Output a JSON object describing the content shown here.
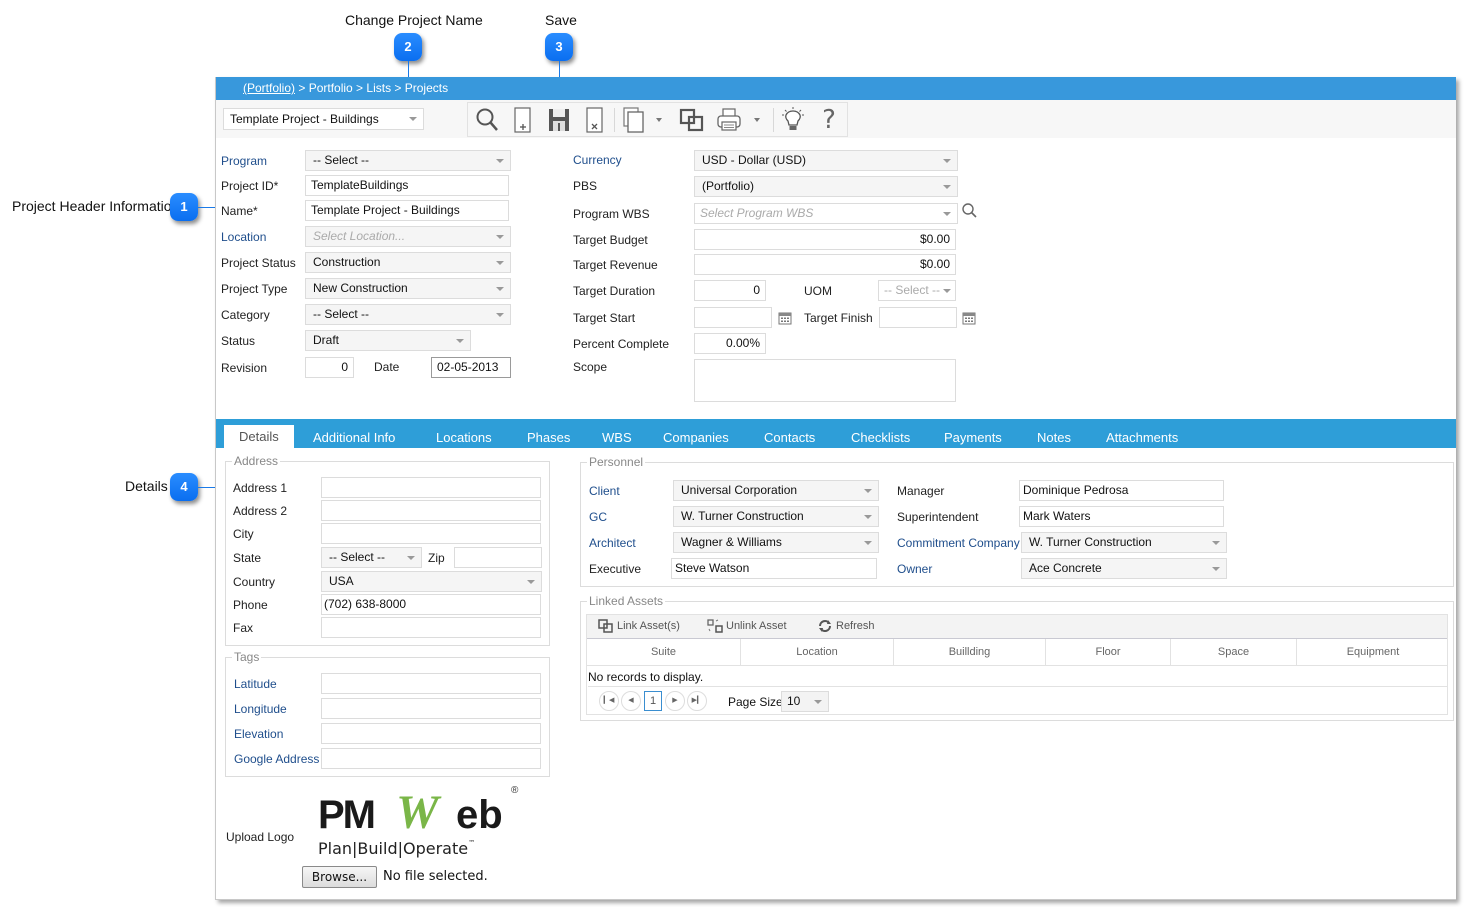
{
  "callouts": [
    {
      "number": "1",
      "label": "Project Header Information"
    },
    {
      "number": "2",
      "label": "Change Project Name"
    },
    {
      "number": "3",
      "label": "Save"
    },
    {
      "number": "4",
      "label": "Details"
    }
  ],
  "breadcrumb": {
    "link": "(Portfolio)",
    "rest": " > Portfolio > Lists > Projects"
  },
  "project_selector": {
    "value": "Template Project - Buildings"
  },
  "toolbar": {
    "icons": [
      "search-icon",
      "new-document-icon",
      "save-icon",
      "delete-document-icon",
      "copy-icon",
      "link-icon",
      "print-icon",
      "lightbulb-icon",
      "help-icon"
    ],
    "help_glyph": "?"
  },
  "header_left": {
    "program": {
      "label": "Program",
      "value": "-- Select --"
    },
    "project_id": {
      "label": "Project ID*",
      "value": "TemplateBuildings"
    },
    "name": {
      "label": "Name*",
      "value": "Template Project - Buildings"
    },
    "location": {
      "label": "Location",
      "placeholder": "Select Location..."
    },
    "project_status": {
      "label": "Project Status",
      "value": "Construction"
    },
    "project_type": {
      "label": "Project Type",
      "value": "New Construction"
    },
    "category": {
      "label": "Category",
      "value": "-- Select --"
    },
    "status": {
      "label": "Status",
      "value": "Draft"
    },
    "revision": {
      "label": "Revision",
      "value": "0"
    },
    "date": {
      "label": "Date",
      "value": "02-05-2013"
    }
  },
  "header_right": {
    "currency": {
      "label": "Currency",
      "value": "USD - Dollar (USD)"
    },
    "pbs": {
      "label": "PBS",
      "value": "(Portfolio)"
    },
    "program_wbs": {
      "label": "Program WBS",
      "placeholder": "Select Program WBS"
    },
    "target_budget": {
      "label": "Target Budget",
      "value": "$0.00"
    },
    "target_revenue": {
      "label": "Target Revenue",
      "value": "$0.00"
    },
    "target_duration": {
      "label": "Target Duration",
      "value": "0"
    },
    "uom": {
      "label": "UOM",
      "value": "-- Select --"
    },
    "target_start": {
      "label": "Target Start",
      "value": ""
    },
    "target_finish": {
      "label": "Target Finish",
      "value": ""
    },
    "percent_complete": {
      "label": "Percent Complete",
      "value": "0.00%"
    },
    "scope": {
      "label": "Scope",
      "value": ""
    }
  },
  "tabs": [
    {
      "label": "Details",
      "active": true
    },
    {
      "label": "Additional Info"
    },
    {
      "label": "Locations"
    },
    {
      "label": "Phases"
    },
    {
      "label": "WBS"
    },
    {
      "label": "Companies"
    },
    {
      "label": "Contacts"
    },
    {
      "label": "Checklists"
    },
    {
      "label": "Payments"
    },
    {
      "label": "Notes"
    },
    {
      "label": "Attachments"
    }
  ],
  "address": {
    "legend": "Address",
    "address1": {
      "label": "Address 1",
      "value": ""
    },
    "address2": {
      "label": "Address 2",
      "value": ""
    },
    "city": {
      "label": "City",
      "value": ""
    },
    "state": {
      "label": "State",
      "value": "-- Select --"
    },
    "zip": {
      "label": "Zip",
      "value": ""
    },
    "country": {
      "label": "Country",
      "value": "USA"
    },
    "phone": {
      "label": "Phone",
      "value": "(702) 638-8000"
    },
    "fax": {
      "label": "Fax",
      "value": ""
    }
  },
  "tags": {
    "legend": "Tags",
    "latitude": {
      "label": "Latitude",
      "value": ""
    },
    "longitude": {
      "label": "Longitude",
      "value": ""
    },
    "elevation": {
      "label": "Elevation",
      "value": ""
    },
    "google_address": {
      "label": "Google Address",
      "value": ""
    }
  },
  "logo": {
    "label": "Upload Logo",
    "brand_pm": "PM",
    "brand_w": "W",
    "brand_eb": "eb",
    "registered": "®",
    "tagline": "Plan|Build|Operate",
    "tm": "™",
    "browse_label": "Browse...",
    "file_status": "No file selected."
  },
  "personnel": {
    "legend": "Personnel",
    "client": {
      "label": "Client",
      "value": "Universal Corporation"
    },
    "gc": {
      "label": "GC",
      "value": "W. Turner Construction"
    },
    "architect": {
      "label": "Architect",
      "value": "Wagner & Williams"
    },
    "executive": {
      "label": "Executive",
      "value": "Steve Watson"
    },
    "manager": {
      "label": "Manager",
      "value": "Dominique Pedrosa"
    },
    "superintendent": {
      "label": "Superintendent",
      "value": "Mark Waters"
    },
    "commitment_company": {
      "label": "Commitment Company",
      "value": "W. Turner Construction"
    },
    "owner": {
      "label": "Owner",
      "value": "Ace Concrete"
    }
  },
  "linked_assets": {
    "legend": "Linked Assets",
    "link_label": "Link Asset(s)",
    "unlink_label": "Unlink Asset",
    "refresh_label": "Refresh",
    "columns": [
      "Suite",
      "Location",
      "Buillding",
      "Floor",
      "Space",
      "Equipment"
    ],
    "empty_message": "No records to display.",
    "current_page": "1",
    "page_size_label": "Page Size",
    "page_size": "10"
  },
  "colors": {
    "header_blue": "#3898dc",
    "tab_blue": "#2e9ed8",
    "badge_blue": "#0a6ef0",
    "label_blue": "#1f4e8c",
    "logo_green": "#7ab648"
  }
}
